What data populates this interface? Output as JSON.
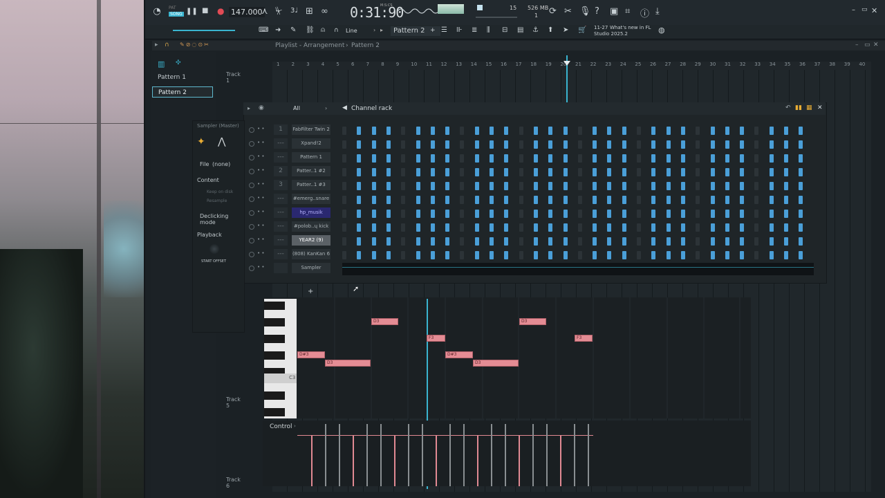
{
  "toolbar": {
    "pat_label": "PAT",
    "song_label": "SONG",
    "tempo": "147.000",
    "time": "0:31:90",
    "time_unit": "M:S:CS",
    "cpu_value": "15",
    "memory": "526 MB",
    "memory_sub": "1",
    "news_date": "11-27",
    "news_title": "What's new in FL",
    "news_sub": "Studio 2025.2",
    "snap_mode": "Line",
    "pattern_selector": "Pattern 2"
  },
  "playlist": {
    "title": "Playlist - Arrangement",
    "breadcrumb": "Pattern 2",
    "patterns": [
      "Pattern 1",
      "Pattern 2"
    ],
    "selected_pattern": "Pattern 2",
    "tracks": [
      "Track 1",
      "Track 5",
      "Track 6"
    ],
    "ruler": [
      "1",
      "2",
      "3",
      "4",
      "5",
      "6",
      "7",
      "8",
      "9",
      "10",
      "11",
      "12",
      "13",
      "14",
      "15",
      "16",
      "17",
      "18",
      "19",
      "20",
      "21",
      "22",
      "23",
      "24",
      "25",
      "26",
      "27",
      "28",
      "29",
      "30",
      "31",
      "32",
      "33",
      "34",
      "35",
      "36",
      "37",
      "38",
      "39",
      "40"
    ]
  },
  "channel_rack": {
    "title": "Channel rack",
    "filter": "All",
    "channels": [
      {
        "num": "1",
        "name": "FabFilter Twin 2"
      },
      {
        "num": "---",
        "name": "Xpand!2"
      },
      {
        "num": "---",
        "name": "Pattern 1"
      },
      {
        "num": "2",
        "name": "Patter..1 #2"
      },
      {
        "num": "3",
        "name": "Patter..1 #3"
      },
      {
        "num": "---",
        "name": "#emerg..snare"
      },
      {
        "num": "---",
        "name": "hp_musik"
      },
      {
        "num": "---",
        "name": "#polob..ɥ kick"
      },
      {
        "num": "---",
        "name": "YEAR2 (9)"
      },
      {
        "num": "---",
        "name": "(808) KanKan 6"
      },
      {
        "num": "",
        "name": "Sampler"
      }
    ],
    "add_button": "+"
  },
  "sampler": {
    "title": "Sampler (Master)",
    "file_label": "File",
    "file_value": "(none)",
    "content_label": "Content",
    "keep_on_disk": "Keep on disk",
    "resample": "Resample",
    "declicking_label": "Declicking mode",
    "playback_label": "Playback",
    "start_offset": "START OFFSET"
  },
  "piano_roll": {
    "key_label": "C3",
    "control_label": "Control",
    "notes": [
      {
        "label": "D3"
      },
      {
        "label": "D#3"
      },
      {
        "label": "D3"
      },
      {
        "label": "F3"
      },
      {
        "label": "D#3"
      },
      {
        "label": "D3"
      },
      {
        "label": "D3"
      },
      {
        "label": "F3"
      }
    ]
  },
  "colors": {
    "accent": "#3ab5d0",
    "step_on": "#4a9fd8",
    "step_off": "#2c3337",
    "note": "#e48c94"
  }
}
